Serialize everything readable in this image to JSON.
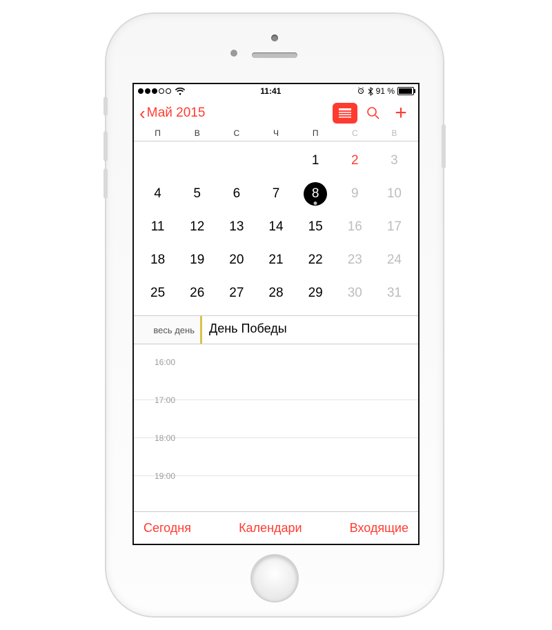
{
  "status": {
    "time": "11:41",
    "battery_pct": "91 %"
  },
  "nav": {
    "back_label": "Май 2015"
  },
  "weekdays": [
    "П",
    "В",
    "С",
    "Ч",
    "П",
    "С",
    "В"
  ],
  "month": {
    "rows": [
      [
        {
          "n": ""
        },
        {
          "n": ""
        },
        {
          "n": ""
        },
        {
          "n": ""
        },
        {
          "n": "1"
        },
        {
          "n": "2",
          "red": true
        },
        {
          "n": "3",
          "dim": true
        }
      ],
      [
        {
          "n": "4"
        },
        {
          "n": "5"
        },
        {
          "n": "6"
        },
        {
          "n": "7"
        },
        {
          "n": "8",
          "today": true,
          "dot": true
        },
        {
          "n": "9",
          "dim": true
        },
        {
          "n": "10",
          "dim": true
        }
      ],
      [
        {
          "n": "11"
        },
        {
          "n": "12"
        },
        {
          "n": "13"
        },
        {
          "n": "14"
        },
        {
          "n": "15"
        },
        {
          "n": "16",
          "dim": true
        },
        {
          "n": "17",
          "dim": true
        }
      ],
      [
        {
          "n": "18"
        },
        {
          "n": "19"
        },
        {
          "n": "20"
        },
        {
          "n": "21"
        },
        {
          "n": "22"
        },
        {
          "n": "23",
          "dim": true
        },
        {
          "n": "24",
          "dim": true
        }
      ],
      [
        {
          "n": "25"
        },
        {
          "n": "26"
        },
        {
          "n": "27"
        },
        {
          "n": "28"
        },
        {
          "n": "29"
        },
        {
          "n": "30",
          "dim": true
        },
        {
          "n": "31",
          "dim": true
        }
      ]
    ]
  },
  "allday": {
    "label": "весь день",
    "event_title": "День Победы"
  },
  "hours": [
    "16:00",
    "17:00",
    "18:00",
    "19:00"
  ],
  "toolbar": {
    "today": "Сегодня",
    "calendars": "Календари",
    "inbox": "Входящие"
  }
}
